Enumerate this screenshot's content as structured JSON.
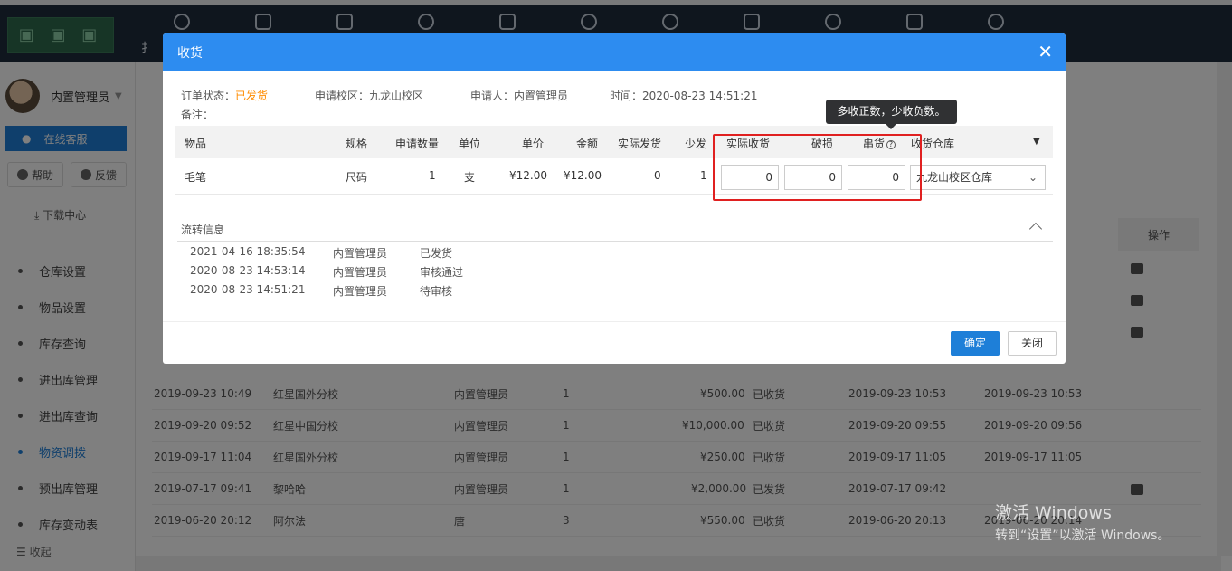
{
  "app": {
    "logo_text": "",
    "nav": [
      {
        "icon": "user-icon",
        "label": "扌"
      },
      {
        "icon": "document-icon",
        "label": ""
      },
      {
        "icon": "book-icon",
        "label": ""
      },
      {
        "icon": "person-icon",
        "label": ""
      },
      {
        "icon": "login-icon",
        "label": ""
      },
      {
        "icon": "home-icon",
        "label": ""
      },
      {
        "icon": "refresh-icon",
        "label": ""
      },
      {
        "icon": "chart-icon",
        "label": ""
      },
      {
        "icon": "settings-icon",
        "label": ""
      },
      {
        "icon": "bug-icon",
        "label": ""
      },
      {
        "icon": "more-icon",
        "label": ""
      }
    ]
  },
  "sidebar": {
    "username": "内置管理员",
    "online_service": "在线客服",
    "help": "帮助",
    "feedback": "反馈",
    "download": "下载中心",
    "menu": [
      {
        "label": "仓库设置",
        "active": false
      },
      {
        "label": "物品设置",
        "active": false
      },
      {
        "label": "库存查询",
        "active": false
      },
      {
        "label": "进出库管理",
        "active": false
      },
      {
        "label": "进出库查询",
        "active": false
      },
      {
        "label": "物资调拨",
        "active": true
      },
      {
        "label": "预出库管理",
        "active": false
      },
      {
        "label": "库存变动表",
        "active": false
      }
    ],
    "collapse": "收起"
  },
  "background_table": {
    "ops_header": "操作",
    "rows": [
      {
        "c1": "2019-09-23 10:49",
        "c2": "红星国外分校",
        "c3": "内置管理员",
        "c4": "1",
        "c5": "¥500.00",
        "c6": "已收货",
        "c7": "2019-09-23 10:53",
        "c8": "2019-09-23 10:53"
      },
      {
        "c1": "2019-09-20 09:52",
        "c2": "红星中国分校",
        "c3": "内置管理员",
        "c4": "1",
        "c5": "¥10,000.00",
        "c6": "已收货",
        "c7": "2019-09-20 09:55",
        "c8": "2019-09-20 09:56"
      },
      {
        "c1": "2019-09-17 11:04",
        "c2": "红星国外分校",
        "c3": "内置管理员",
        "c4": "1",
        "c5": "¥250.00",
        "c6": "已收货",
        "c7": "2019-09-17 11:05",
        "c8": "2019-09-17 11:05"
      },
      {
        "c1": "2019-07-17 09:41",
        "c2": "黎哈哈",
        "c3": "内置管理员",
        "c4": "1",
        "c5": "¥2,000.00",
        "c6": "已发货",
        "c7": "2019-07-17 09:42",
        "c8": ""
      },
      {
        "c1": "2019-06-20 20:12",
        "c2": "阿尔法",
        "c3": "唐",
        "c4": "3",
        "c5": "¥550.00",
        "c6": "已收货",
        "c7": "2019-06-20 20:13",
        "c8": "2019-06-20 20:14"
      }
    ]
  },
  "modal": {
    "title": "收货",
    "order_status_label": "订单状态：",
    "order_status_value": "已发货",
    "campus_label": "申请校区：",
    "campus_value": "九龙山校区",
    "applicant_label": "申请人：",
    "applicant_value": "内置管理员",
    "time_label": "时间：",
    "time_value": "2020-08-23 14:51:21",
    "remark_label": "备注：",
    "tooltip": "多收正数，少收负数。",
    "columns": [
      "物品",
      "规格",
      "申请数量",
      "单位",
      "单价",
      "金额",
      "实际发货",
      "少发",
      "实际收货",
      "破损",
      "串货",
      "收货仓库"
    ],
    "item": {
      "name": "毛笔",
      "spec": "尺码",
      "qty": "1",
      "unit": "支",
      "price": "¥12.00",
      "amount": "¥12.00",
      "shipped": "0",
      "short": "1",
      "received": "0",
      "damaged": "0",
      "mixed": "0",
      "warehouse": "九龙山校区仓库"
    },
    "flow_title": "流转信息",
    "flow": [
      {
        "time": "2021-04-16 18:35:54",
        "user": "内置管理员",
        "status": "已发货"
      },
      {
        "time": "2020-08-23 14:53:14",
        "user": "内置管理员",
        "status": "审核通过"
      },
      {
        "time": "2020-08-23 14:51:21",
        "user": "内置管理员",
        "status": "待审核"
      }
    ],
    "confirm": "确定",
    "close": "关闭"
  },
  "watermark": {
    "line1": "激活 Windows",
    "line2": "转到“设置”以激活 Windows。"
  }
}
